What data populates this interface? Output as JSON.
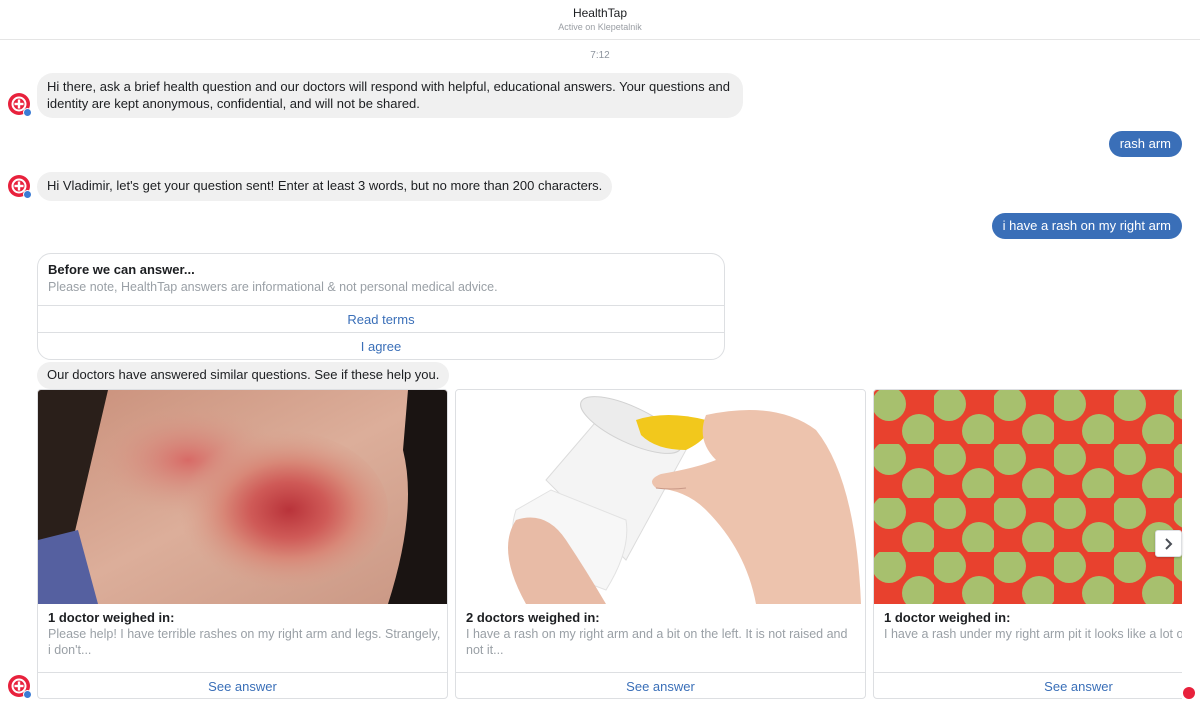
{
  "header": {
    "title": "HealthTap",
    "status": "Active on Klepetalnik"
  },
  "time": "7:12",
  "messages": {
    "intro": "Hi there, ask a brief health question and our doctors will respond with helpful, educational answers. Your questions and identity are kept anonymous, confidential, and will not be shared.",
    "user1": "rash arm",
    "prompt": "Hi Vladimir, let's get your question sent! Enter at least 3 words, but no more than 200 characters.",
    "user2": "i have a rash on my right arm",
    "similar": "Our doctors have answered similar questions. See if these help you."
  },
  "terms_card": {
    "title": "Before we can answer...",
    "subtitle": "Please note, HealthTap answers are informational & not personal medical advice.",
    "buttons": [
      "Read terms",
      "I agree"
    ]
  },
  "answers": [
    {
      "title": "1 doctor weighed in:",
      "text": "Please help! I have terrible rashes on my right arm and legs. Strangely, i don't...",
      "button": "See answer",
      "image": "rash-on-skin-photo"
    },
    {
      "title": "2 doctors weighed in:",
      "text": "I have a rash on my right arm and a bit on the left. It is not raised and not it...",
      "button": "See answer",
      "image": "ointment-jar-photo"
    },
    {
      "title": "1 doctor weighed in:",
      "text": "I have a rash under my right arm pit it looks like a lot of pimples wirh a...",
      "button": "See answer",
      "image": "polka-dot-pattern-photo"
    }
  ],
  "colors": {
    "accent": "#3a6fb8",
    "brand": "#e8213c",
    "bubble_in": "#f0f0f0"
  },
  "icons": {
    "avatar": "healthtap-logo-icon",
    "next": "chevron-right-icon"
  }
}
